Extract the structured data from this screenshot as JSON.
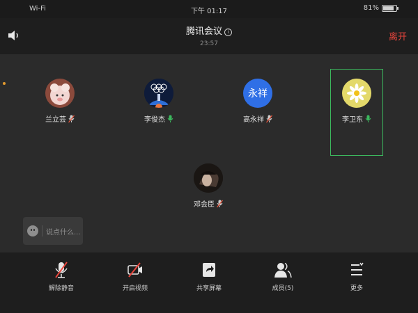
{
  "status_bar": {
    "network": "Wi-Fi",
    "time": "下午 01:17",
    "battery": "81%",
    "battery_level": 0.81
  },
  "header": {
    "title": "腾讯会议",
    "duration": "23:57",
    "leave_label": "离开"
  },
  "participants": [
    {
      "name": "兰立芸",
      "mic": "muted",
      "avatar_text": ""
    },
    {
      "name": "李俊杰",
      "mic": "on",
      "avatar_text": ""
    },
    {
      "name": "高永祥",
      "mic": "muted",
      "avatar_text": "永祥"
    },
    {
      "name": "李卫东",
      "mic": "on",
      "avatar_text": "",
      "active": true
    },
    {
      "name": "邓会臣",
      "mic": "muted",
      "avatar_text": ""
    }
  ],
  "chat": {
    "placeholder": "说点什么..."
  },
  "toolbar": {
    "items": [
      {
        "label": "解除静音",
        "icon": "mic-muted-icon"
      },
      {
        "label": "开启视频",
        "icon": "video-off-icon"
      },
      {
        "label": "共享屏幕",
        "icon": "share-screen-icon"
      },
      {
        "label": "成员(5)",
        "icon": "members-icon"
      },
      {
        "label": "更多",
        "icon": "more-icon"
      }
    ]
  },
  "colors": {
    "leave": "#e8453c",
    "active_border": "#3cb95e",
    "avatar_blue": "#2f6fe6",
    "mic_on": "#3cb95e",
    "mic_muted": "#e8553c"
  }
}
